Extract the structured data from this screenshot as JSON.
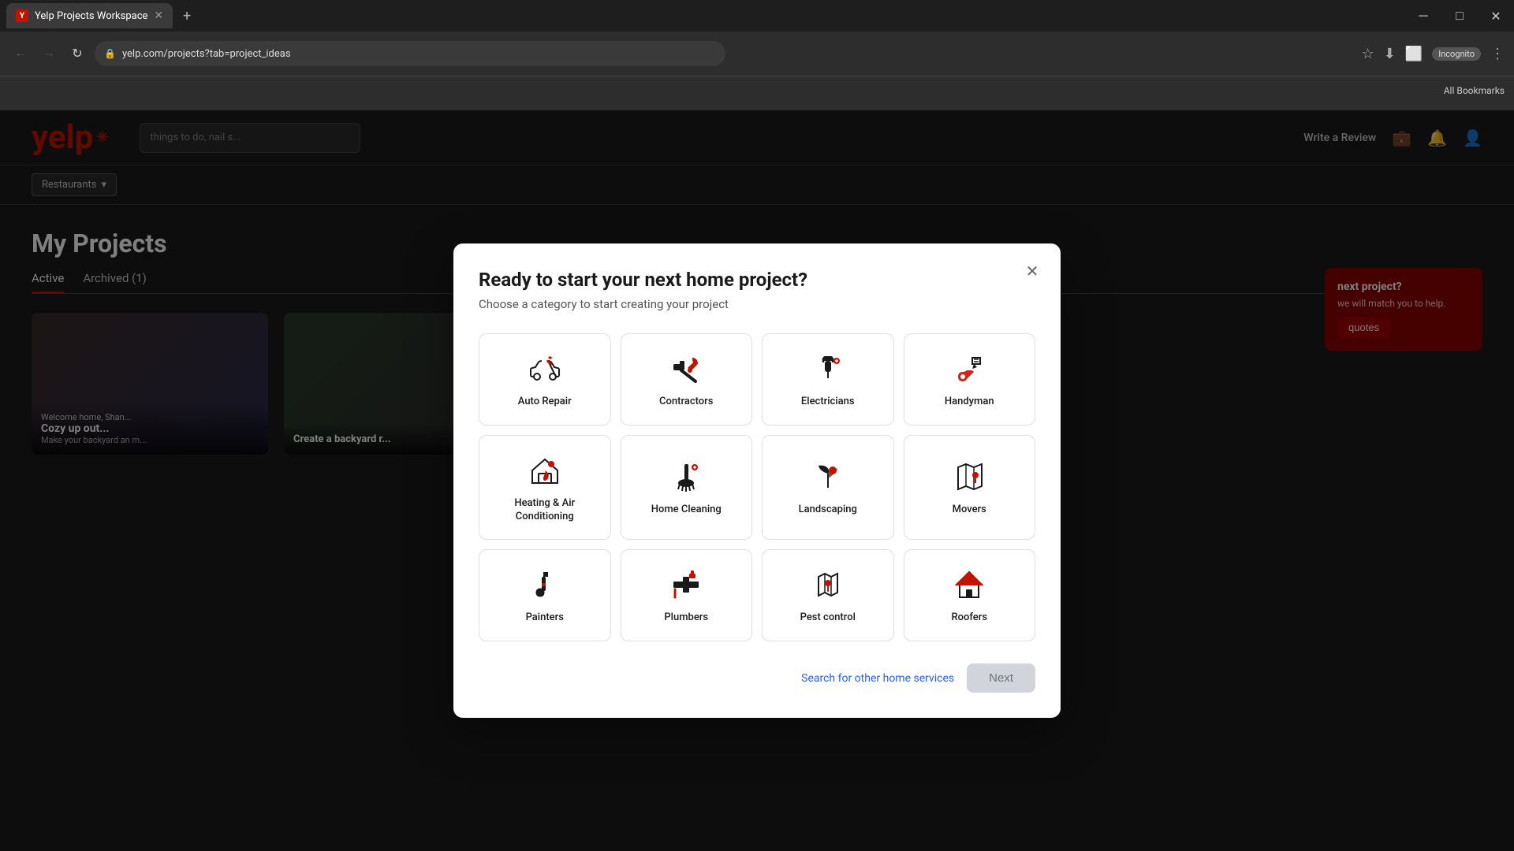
{
  "browser": {
    "tab_label": "Yelp Projects Workspace",
    "tab_favicon": "Y",
    "url": "yelp.com/projects?tab=project_ideas",
    "incognito_label": "Incognito",
    "bookmarks_label": "All Bookmarks",
    "window_min": "─",
    "window_max": "□",
    "window_close": "✕"
  },
  "header": {
    "logo": "yelp",
    "search_placeholder": "things to do, nail s...",
    "nav": [
      "Restaurants"
    ],
    "write_review": "Write a Review"
  },
  "page": {
    "title": "My Projects",
    "tabs": [
      "Active",
      "Archived (1)"
    ],
    "active_tab": "Active"
  },
  "modal": {
    "title": "Ready to start your next home project?",
    "subtitle": "Choose a category to start creating your project",
    "close_label": "✕",
    "categories": [
      {
        "id": "auto-repair",
        "label": "Auto Repair",
        "icon": "auto"
      },
      {
        "id": "contractors",
        "label": "Contractors",
        "icon": "contractors"
      },
      {
        "id": "electricians",
        "label": "Electricians",
        "icon": "electricians"
      },
      {
        "id": "handyman",
        "label": "Handyman",
        "icon": "handyman"
      },
      {
        "id": "heating-air",
        "label": "Heating & Air Conditioning",
        "icon": "hvac"
      },
      {
        "id": "home-cleaning",
        "label": "Home Cleaning",
        "icon": "cleaning"
      },
      {
        "id": "landscaping",
        "label": "Landscaping",
        "icon": "landscaping"
      },
      {
        "id": "movers",
        "label": "Movers",
        "icon": "movers"
      },
      {
        "id": "painters",
        "label": "Painters",
        "icon": "painters"
      },
      {
        "id": "plumbers",
        "label": "Plumbers",
        "icon": "plumbers"
      },
      {
        "id": "pest-control",
        "label": "Pest control",
        "icon": "pest"
      },
      {
        "id": "roofers",
        "label": "Roofers",
        "icon": "roofers"
      }
    ],
    "search_other_label": "Search for other home services",
    "next_label": "Next"
  },
  "sidebar_right": {
    "title": "next project?",
    "desc1": "we will match you",
    "desc2": "to help.",
    "quotes_btn": "quotes"
  }
}
